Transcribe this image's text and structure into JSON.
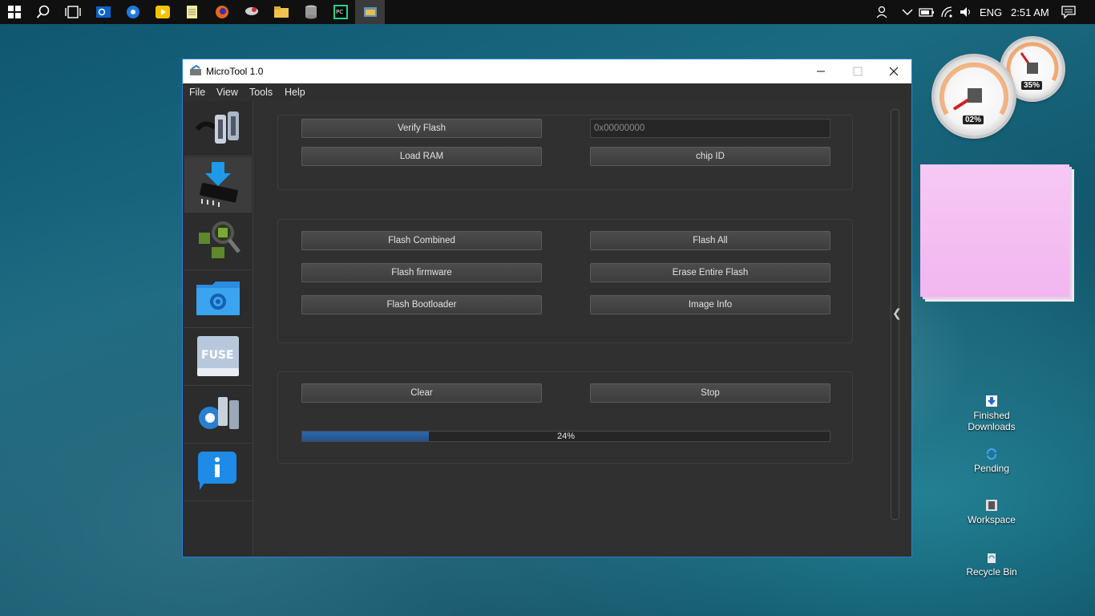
{
  "taskbar": {
    "icons": [
      "windows-start-icon",
      "search-icon",
      "task-view-icon",
      "outlook-icon",
      "groove-music-icon",
      "media-player-icon",
      "notepad-icon",
      "firefox-icon",
      "snipping-tool-icon",
      "file-explorer-icon",
      "database-icon",
      "pycharm-icon",
      "microtool-app-icon"
    ],
    "tray": {
      "language": "ENG",
      "time": "2:51 AM"
    }
  },
  "window": {
    "title": "MicroTool 1.0",
    "menu": [
      "File",
      "View",
      "Tools",
      "Help"
    ],
    "sidebar": [
      "serial-connector-icon",
      "download-chip-icon",
      "chip-inspect-icon",
      "settings-folder-icon",
      "fuse-drive-icon",
      "port-settings-icon",
      "info-icon"
    ],
    "group1": {
      "verify_flash": "Verify Flash",
      "address_placeholder": "0x00000000",
      "load_ram": "Load RAM",
      "chip_id": "chip ID"
    },
    "group2": {
      "flash_combined": "Flash Combined",
      "flash_all": "Flash All",
      "flash_firmware": "Flash firmware",
      "erase_flash": "Erase Entire Flash",
      "flash_bootloader": "Flash Bootloader",
      "image_info": "Image Info"
    },
    "group3": {
      "clear": "Clear",
      "stop": "Stop",
      "progress_value": 0.24,
      "progress_text": "24%"
    }
  },
  "desktop": {
    "gauges": {
      "cpu": "02%",
      "memory": "35%"
    },
    "icons": {
      "finished_downloads": "Finished Downloads",
      "pending": "Pending",
      "workspace": "Workspace",
      "recycle_bin": "Recycle Bin"
    }
  },
  "colors": {
    "accent": "#2a7fd8",
    "progress": "#2a5f9e",
    "window_bg": "#303030"
  }
}
